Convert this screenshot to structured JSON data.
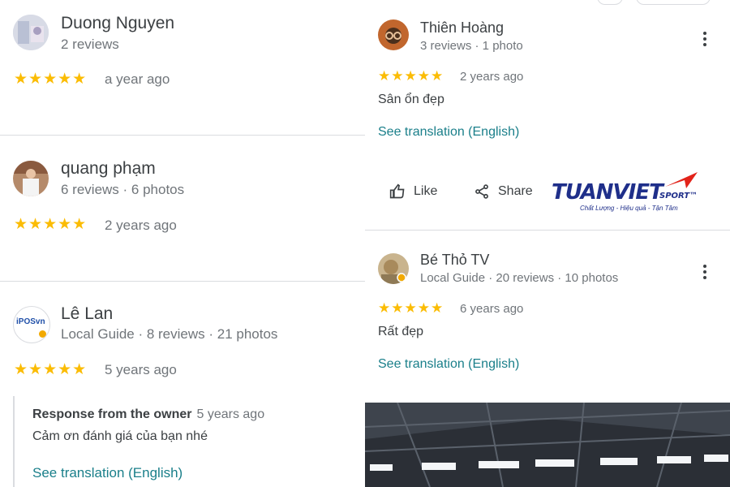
{
  "left_reviews": [
    {
      "name": "Duong Nguyen",
      "meta": "2 reviews",
      "stars": "★★★★★",
      "when": "a year ago"
    },
    {
      "name": "quang phạm",
      "meta": "6 reviews · 6 photos",
      "stars": "★★★★★",
      "when": "2 years ago"
    },
    {
      "name": "Lê Lan",
      "meta": "Local Guide · 8 reviews · 21 photos",
      "stars": "★★★★★",
      "when": "5 years ago",
      "avatar_text": "iPOSvn",
      "owner_response": {
        "label": "Response from the owner",
        "when": "5 years ago",
        "text": "Cảm ơn đánh giá của bạn nhé",
        "translate": "See translation (English)"
      }
    }
  ],
  "right_reviews": [
    {
      "name": "Thiên Hoàng",
      "meta": "3 reviews · 1 photo",
      "stars": "★★★★★",
      "when": "2 years ago",
      "text": "Sân ổn đẹp",
      "translate": "See translation (English)"
    },
    {
      "name": "Bé Thỏ TV",
      "meta": "Local Guide · 20 reviews · 10 photos",
      "stars": "★★★★★",
      "when": "6 years ago",
      "text": "Rất đẹp",
      "translate": "See translation (English)"
    }
  ],
  "actions": {
    "like": "Like",
    "share": "Share"
  },
  "logo": {
    "main": "TUANVIET",
    "sub": "SPORT™",
    "tagline": "Chất Lượng - Hiệu quả - Tận Tâm"
  },
  "colors": {
    "star": "#fbbc04",
    "link": "#1a7f8a",
    "logo": "#1f2f8a",
    "logo_accent": "#e2231a"
  }
}
